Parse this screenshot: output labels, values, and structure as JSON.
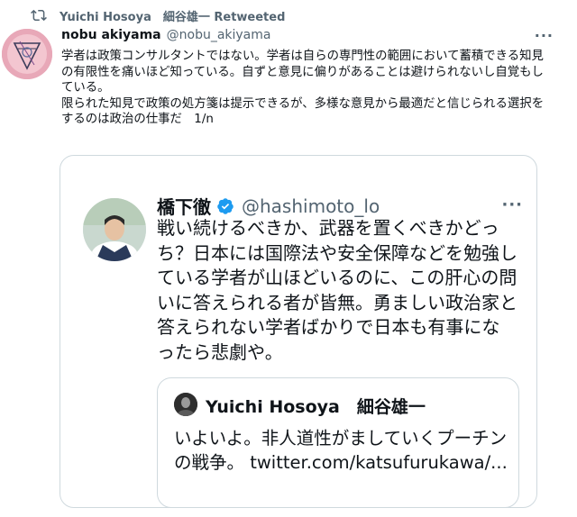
{
  "retweet": {
    "icon": "retweet-icon",
    "text": "Yuichi Hosoya　細谷雄一 Retweeted"
  },
  "tweet": {
    "name": "nobu akiyama",
    "handle": "@nobu_akiyama",
    "more": "···",
    "text": "学者は政策コンサルタントではない。学者は自らの専門性の範囲において蓄積できる知見の有限性を痛いほど知っている。自ずと意見に偏りがあることは避けられないし自覚もしている。\n限られた知見で政策の処方箋は提示できるが、多様な意見から最適だと信じられる選択をするのは政治の仕事だ　1/n"
  },
  "quote": {
    "name": "橋下徹",
    "verified_icon": "verified-badge-icon",
    "handle": "@hashimoto_lo",
    "more": "···",
    "text": "戦い続けるべきか、武器を置くべきかどっち？日本には国際法や安全保障などを勉強している学者が山ほどいるのに、この肝心の問いに答えられる者が皆無。勇ましい政治家と答えられない学者ばかりで日本も有事になったら悲劇や。"
  },
  "inner_quote": {
    "name": "Yuichi Hosoya　細谷雄一",
    "text": "いよいよ。非人道性がましていくプーチンの戦争。 twitter.com/katsufurukawa/..."
  },
  "colors": {
    "text": "#0f1419",
    "muted": "#536471",
    "border": "#cfd9de",
    "verified": "#1d9bf0"
  }
}
